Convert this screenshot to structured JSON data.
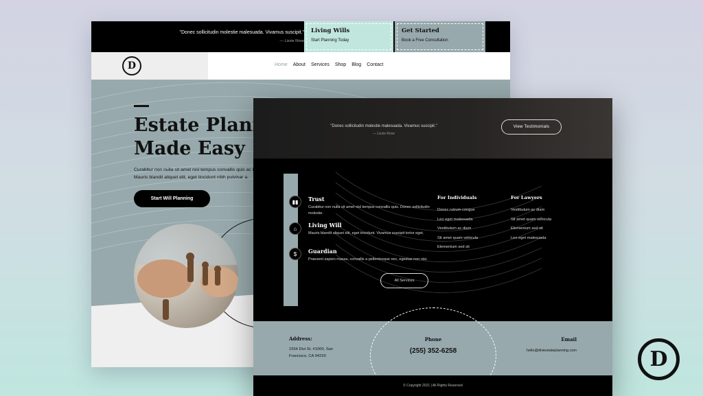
{
  "back_page": {
    "topbar": {
      "quote": "\"Donec sollicitudin molestie malesuada. Vivamus suscipit.\"",
      "quote_author": "— Lizzie Rose",
      "promo_left": {
        "title": "Living Wills",
        "subtitle": "Start Planning Today"
      },
      "promo_right": {
        "title": "Get Started",
        "subtitle": "Book a Free Consultation"
      }
    },
    "nav": {
      "logo_letter": "D",
      "items": [
        "Home",
        "About",
        "Services",
        "Shop",
        "Blog",
        "Contact"
      ],
      "active": "Home"
    },
    "hero": {
      "title_line1": "Estate Planning",
      "title_line2": "Made Easy",
      "paragraph": "Curabitur non nulla sit amet nisl tempus convallis quis ac lectus. Mauris blandit aliquet elit, eget tincidunt nibh pulvinar a.",
      "cta_label": "Start Will Planning"
    }
  },
  "front_page": {
    "band": {
      "quote": "\"Donec sollicitudin molestie malesuada. Vivamus suscipit.\"",
      "quote_author": "— Lizzie Rose",
      "button_label": "View Testimonials"
    },
    "services": [
      {
        "title": "Trust",
        "desc": "Curabitur non nulla sit amet nisl tempus convallis quis. Donec sollicitudin molestie."
      },
      {
        "title": "Living Will",
        "desc": "Mauris blandit aliquet elit, eget tincidunt. Vivamus suscipit tortor eget."
      },
      {
        "title": "Guardian",
        "desc": "Praesent sapien massa, convallis a pellentesque nec, egestas non nisi."
      }
    ],
    "individuals": {
      "heading": "For Individuals",
      "items": [
        "Donec rutrum congue",
        "Leo eget malesuada",
        "Vestibulum ac diam",
        "Sit amet quam vehicula",
        "Elementum sed sit"
      ]
    },
    "lawyers": {
      "heading": "For Lawyers",
      "items": [
        "Vestibulum ac diam",
        "Sit amet quam vehicula",
        "Elementum sed sit",
        "Leo eget malesuada"
      ]
    },
    "all_services_label": "All Services",
    "contact": {
      "address_label": "Address:",
      "address_line1": "1554 Divi St. #1000, San",
      "address_line2": "Francisco, CA 94220",
      "phone_label": "Phone",
      "phone_value": "(255) 352-6258",
      "email_label": "Email",
      "email_value": "hello@diviestateplanning.com"
    },
    "footer": "© Copyright 2021 | All Rights Reserved"
  },
  "brand_logo_letter": "D",
  "icons": {
    "sidebar_1": "trust-icon",
    "sidebar_2": "house-icon",
    "sidebar_3": "moneybag-icon"
  },
  "colors": {
    "sage": "#97a9ac",
    "mint": "#c0e6de",
    "black": "#000000"
  }
}
